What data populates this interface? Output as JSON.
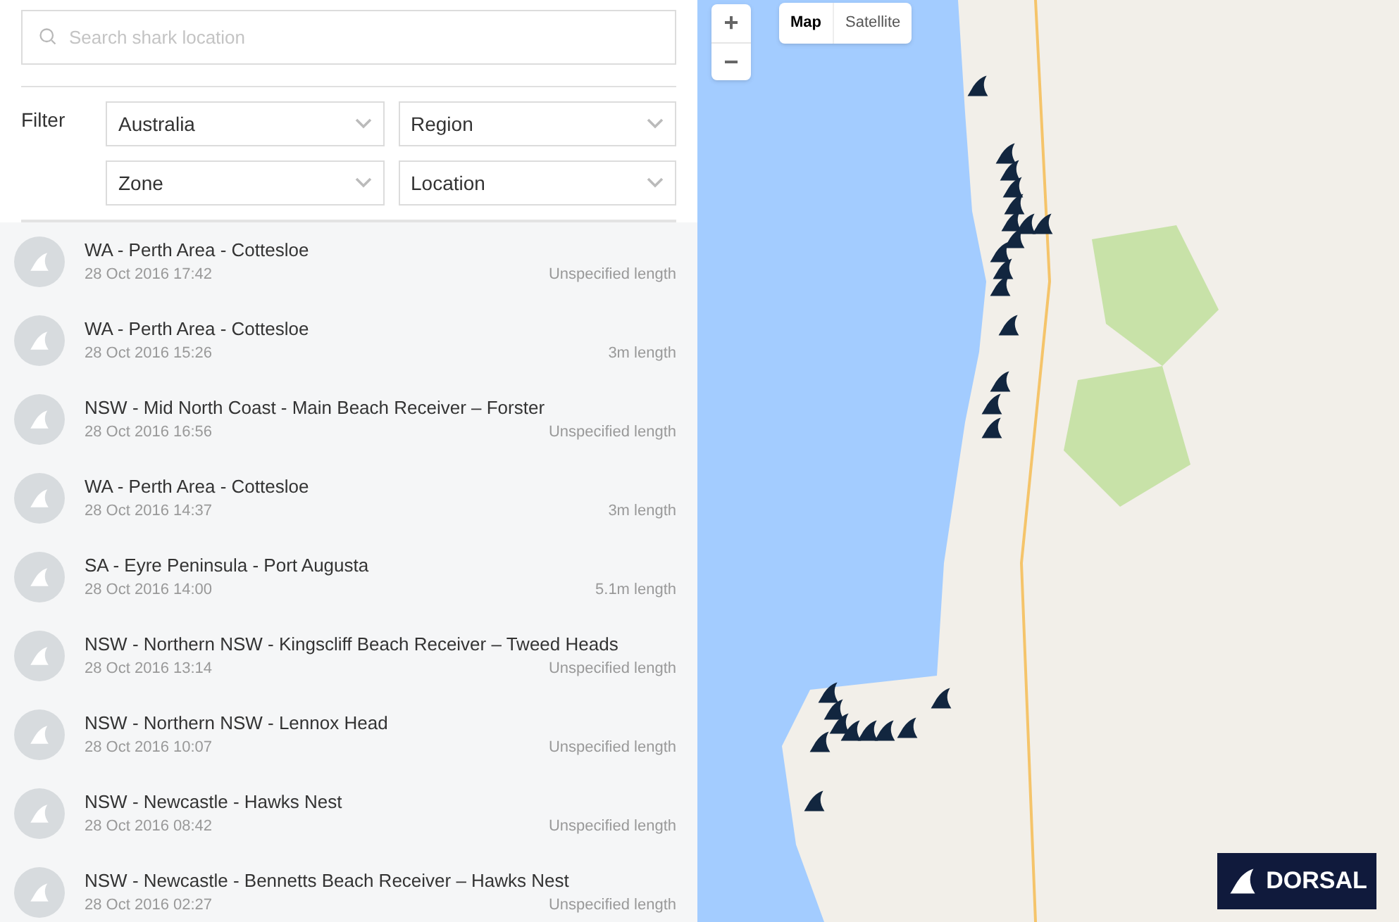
{
  "search": {
    "placeholder": "Search shark location"
  },
  "filter": {
    "label": "Filter",
    "dropdowns": [
      {
        "value": "Australia"
      },
      {
        "value": "Region"
      },
      {
        "value": "Zone"
      },
      {
        "value": "Location"
      }
    ]
  },
  "sightings": [
    {
      "title": "WA - Perth Area - Cottesloe",
      "time": "28 Oct 2016 17:42",
      "length": "Unspecified length"
    },
    {
      "title": "WA - Perth Area - Cottesloe",
      "time": "28 Oct 2016 15:26",
      "length": "3m length"
    },
    {
      "title": "NSW - Mid North Coast - Main Beach Receiver – Forster",
      "time": "28 Oct 2016 16:56",
      "length": "Unspecified length"
    },
    {
      "title": "WA - Perth Area - Cottesloe",
      "time": "28 Oct 2016 14:37",
      "length": "3m length"
    },
    {
      "title": "SA - Eyre Peninsula - Port Augusta",
      "time": "28 Oct 2016 14:00",
      "length": "5.1m length"
    },
    {
      "title": "NSW - Northern NSW - Kingscliff Beach Receiver – Tweed Heads",
      "time": "28 Oct 2016 13:14",
      "length": "Unspecified length"
    },
    {
      "title": "NSW - Northern NSW - Lennox Head",
      "time": "28 Oct 2016 10:07",
      "length": "Unspecified length"
    },
    {
      "title": "NSW - Newcastle - Hawks Nest",
      "time": "28 Oct 2016 08:42",
      "length": "Unspecified length"
    },
    {
      "title": "NSW - Newcastle - Bennetts Beach Receiver – Hawks Nest",
      "time": "28 Oct 2016 02:27",
      "length": "Unspecified length"
    }
  ],
  "map": {
    "zoom_in": "+",
    "zoom_out": "−",
    "map_types": [
      {
        "label": "Map",
        "selected": true
      },
      {
        "label": "Satellite",
        "selected": false
      }
    ],
    "logo": "DORSAL"
  }
}
